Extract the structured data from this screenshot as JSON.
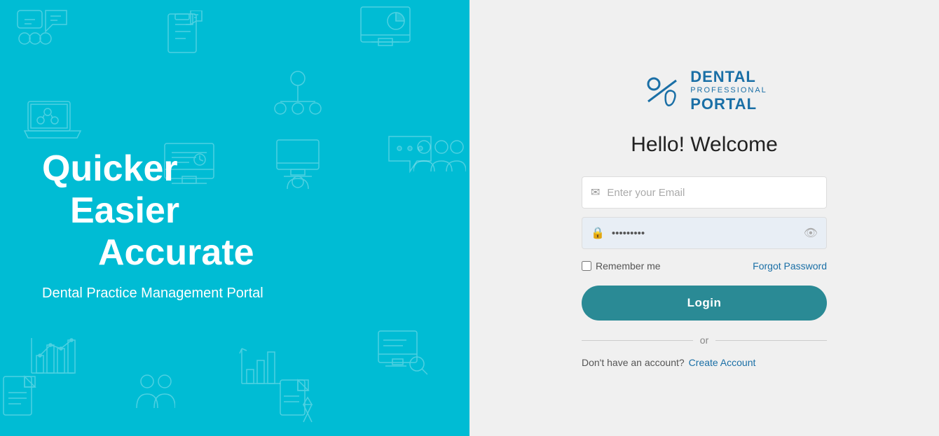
{
  "left": {
    "tagline_line1": "Quicker",
    "tagline_line2": "Easier",
    "tagline_line3": "Accurate",
    "subtitle": "Dental Practice Management Portal",
    "bg_color": "#00BCD4"
  },
  "right": {
    "logo": {
      "dental": "DENTAL",
      "professional": "PROFESSIONAL",
      "portal": "PORTAL"
    },
    "welcome": "Hello! Welcome",
    "email_placeholder": "Enter your Email",
    "password_value": "·········",
    "remember_me_label": "Remember me",
    "forgot_password_label": "Forgot Password",
    "login_button_label": "Login",
    "divider_text": "or",
    "no_account_text": "Don't have an account?",
    "create_account_label": "Create Account"
  }
}
